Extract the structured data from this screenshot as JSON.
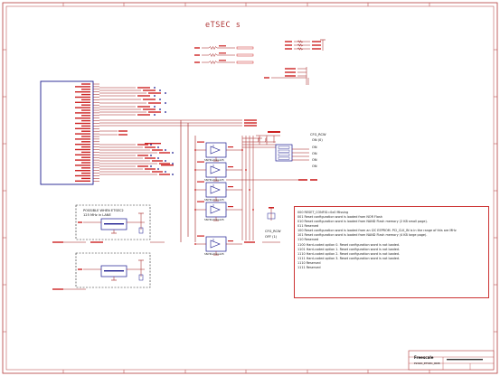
{
  "sheet": {
    "title": "eTSEC s",
    "border_color": "#b23a3a",
    "net_color": "#cc2222",
    "wire_color": "#a01818",
    "part_color": "#1b1b8f"
  },
  "modes": {
    "on_header": "ON (0)",
    "off_header": "OFF (1)",
    "on_values": [
      "ON",
      "ON",
      "ON",
      "ON"
    ],
    "off_block_a": "CFG_RCW",
    "off_block_b": "OFF (1)"
  },
  "buffers": {
    "part_names": [
      "SN74LVC1G125",
      "SN74LVC1G125",
      "SN74LVC1G125",
      "SN74LVC1G125",
      "SN74LVC1G125"
    ]
  },
  "clocks": {
    "caption_lines": [
      "POSSIBLE WHEN ETSEC2",
      "125 MHz in LANE"
    ]
  },
  "notes": [
    "000 RESET_CONFIG=0x0 Missing",
    "001 Reset configuration word is loaded from NOR Flash",
    "010 Reset configuration word is loaded from NAND Flash memory (2 KB small page).",
    "011 Reserved",
    "100 Reset configuration word is loaded from an I2C EEPROM. PCI_CLK_IN is in the range of this are MHz",
    "101 Reset configuration word is loaded from NAND Flash memory (4 KB large page).",
    "110 Reserved",
    "1100 Hard-coded option 0. Reset configuration word is not loaded.",
    "1101 Hard-coded option 1. Reset configuration word is not loaded.",
    "1110 Hard-coded option 2. Reset configuration word is not loaded.",
    "1111 Hard-coded option 3. Reset configuration word is not loaded.",
    "1110 Reserved",
    "1111 Reserved"
  ],
  "titleblock": {
    "company": "Freescale",
    "doc": "P2020_ETSEC_RDB"
  }
}
